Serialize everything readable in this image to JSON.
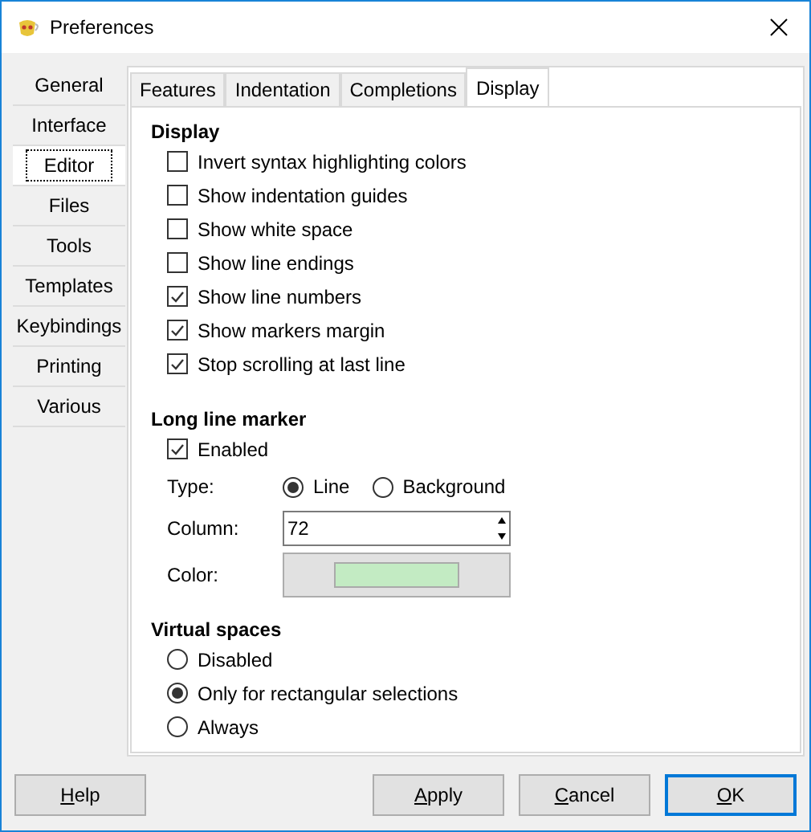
{
  "window": {
    "title": "Preferences"
  },
  "sidebar": {
    "items": [
      {
        "label": "General",
        "selected": false
      },
      {
        "label": "Interface",
        "selected": false
      },
      {
        "label": "Editor",
        "selected": true
      },
      {
        "label": "Files",
        "selected": false
      },
      {
        "label": "Tools",
        "selected": false
      },
      {
        "label": "Templates",
        "selected": false
      },
      {
        "label": "Keybindings",
        "selected": false
      },
      {
        "label": "Printing",
        "selected": false
      },
      {
        "label": "Various",
        "selected": false
      }
    ]
  },
  "tabs": [
    {
      "label": "Features",
      "selected": false
    },
    {
      "label": "Indentation",
      "selected": false
    },
    {
      "label": "Completions",
      "selected": false
    },
    {
      "label": "Display",
      "selected": true
    }
  ],
  "display": {
    "heading": "Display",
    "options": [
      {
        "label": "Invert syntax highlighting colors",
        "checked": false
      },
      {
        "label": "Show indentation guides",
        "checked": false
      },
      {
        "label": "Show white space",
        "checked": false
      },
      {
        "label": "Show line endings",
        "checked": false
      },
      {
        "label": "Show line numbers",
        "checked": true
      },
      {
        "label": "Show markers margin",
        "checked": true
      },
      {
        "label": "Stop scrolling at last line",
        "checked": true
      }
    ]
  },
  "long_line_marker": {
    "heading": "Long line marker",
    "enabled": {
      "label": "Enabled",
      "checked": true
    },
    "type_label": "Type:",
    "types": [
      {
        "label": "Line",
        "selected": true
      },
      {
        "label": "Background",
        "selected": false
      }
    ],
    "column_label": "Column:",
    "column_value": "72",
    "color_label": "Color:",
    "color": "#c3ebc3"
  },
  "virtual_spaces": {
    "heading": "Virtual spaces",
    "options": [
      {
        "label": "Disabled",
        "selected": false
      },
      {
        "label": "Only for rectangular selections",
        "selected": true
      },
      {
        "label": "Always",
        "selected": false
      }
    ]
  },
  "buttons": [
    {
      "label": "Help",
      "default": false
    },
    {
      "label": "Apply",
      "default": false
    },
    {
      "label": "Cancel",
      "default": false
    },
    {
      "label": "OK",
      "default": true
    }
  ]
}
